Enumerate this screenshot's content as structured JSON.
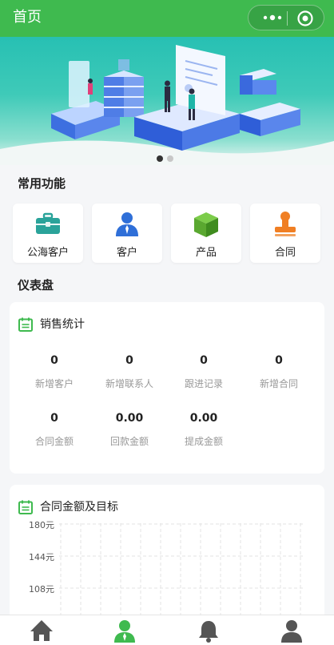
{
  "header": {
    "title": "首页",
    "more_icon": "more-dots-icon",
    "close_icon": "target-close-icon",
    "bg_color": "#3fba4f"
  },
  "banner": {
    "slides_count": 2,
    "active_slide": 1
  },
  "quick_functions": {
    "title": "常用功能",
    "items": [
      {
        "label": "公海客户",
        "icon": "briefcase-icon",
        "color": "#2aa39a"
      },
      {
        "label": "客户",
        "icon": "person-icon",
        "color": "#2f6fd8"
      },
      {
        "label": "产品",
        "icon": "box-icon",
        "color": "#5aa830"
      },
      {
        "label": "合同",
        "icon": "stamp-icon",
        "color": "#f07f24"
      }
    ]
  },
  "dashboard": {
    "title": "仪表盘",
    "sales": {
      "title": "销售统计",
      "icon": "calendar-icon",
      "stats": [
        {
          "value": "0",
          "label": "新增客户"
        },
        {
          "value": "0",
          "label": "新增联系人"
        },
        {
          "value": "0",
          "label": "跟进记录"
        },
        {
          "value": "0",
          "label": "新增合同"
        },
        {
          "value": "0",
          "label": "合同金额"
        },
        {
          "value": "0.00",
          "label": "回款金额"
        },
        {
          "value": "0.00",
          "label": "提成金额"
        }
      ]
    },
    "contract_chart": {
      "title": "合同金额及目标",
      "icon": "calendar-icon",
      "y_ticks": [
        "180元",
        "144元",
        "108元"
      ]
    }
  },
  "tabbar": {
    "items": [
      {
        "icon": "home-icon",
        "active": false
      },
      {
        "icon": "user-manager-icon",
        "active": true
      },
      {
        "icon": "bell-icon",
        "active": false
      },
      {
        "icon": "profile-icon",
        "active": false
      }
    ]
  }
}
